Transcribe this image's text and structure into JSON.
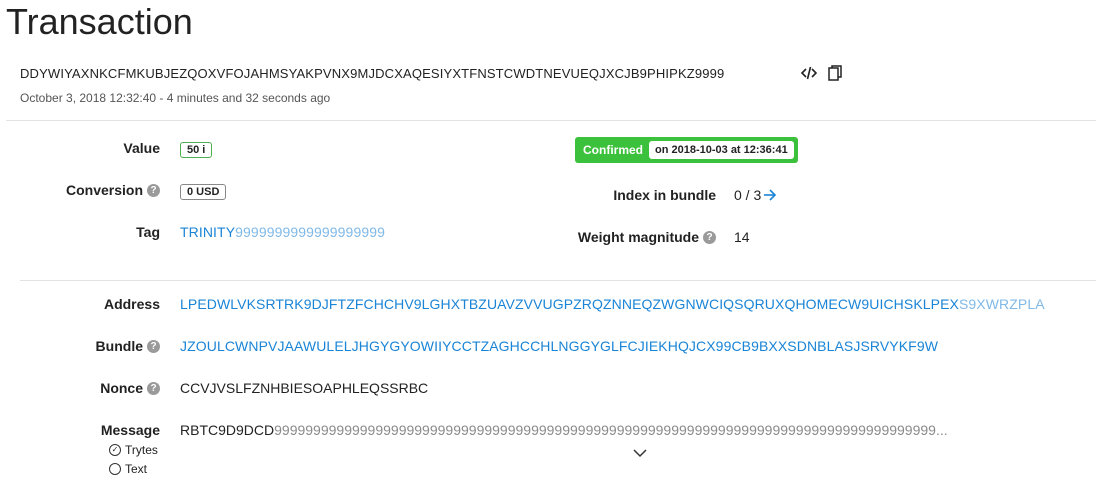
{
  "page": {
    "title": "Transaction",
    "hash": "DDYWIYAXNKCFMKUBJEZQOXVFOJAHMSYAKPVNX9MJDCXAQESIYXTFNSTCWDTNEVUEQJXCJB9PHIPKZ9999",
    "date": "October 3, 2018 12:32:40 - 4 minutes and 32 seconds ago"
  },
  "status": {
    "label": "Confirmed",
    "date": "on 2018-10-03 at 12:36:41"
  },
  "fields": {
    "value_label": "Value",
    "value": "50 i",
    "conversion_label": "Conversion",
    "conversion": "0 USD",
    "tag_label": "Tag",
    "tag_main": "TRINITY",
    "tag_rest": "9999999999999999999",
    "index_label": "Index in bundle",
    "index": "0 / 3",
    "weight_label": "Weight magnitude",
    "weight": "14",
    "address_label": "Address",
    "address_main": "LPEDWLVKSRTRK9DJFTZFCHCHV9LGHXTBZUAVZVVUGPZRQZNNEQZWGNWCIQSQRUXQHOMECW9UICHSKLPEX",
    "address_checksum": "S9XWRZPLA",
    "bundle_label": "Bundle",
    "bundle": "JZOULCWNPVJAAWULELJHGYGYOWIIYCCTZAGHCCHLNGGYGLFCJIEKHQJCX99CB9BXXSDNBLASJSRVYKF9W",
    "nonce_label": "Nonce",
    "nonce": "CCVJVSLFZNHBIESOAPHLEQSSRBC",
    "message_label": "Message",
    "message_main": "RBTC9D9DCD",
    "message_rest": "9999999999999999999999999999999999999999999999999999999999999999999999999999999999999...",
    "trytes_label": "Trytes",
    "text_label": "Text"
  },
  "icons": {
    "code": "code-icon",
    "copy": "copy-icon",
    "arrow": "arrow-right-icon",
    "help": "help-icon",
    "expand": "chevron-down-icon"
  },
  "colors": {
    "confirmed": "#3cc13c",
    "link": "#1a84d6",
    "value_border": "#4caf50"
  }
}
